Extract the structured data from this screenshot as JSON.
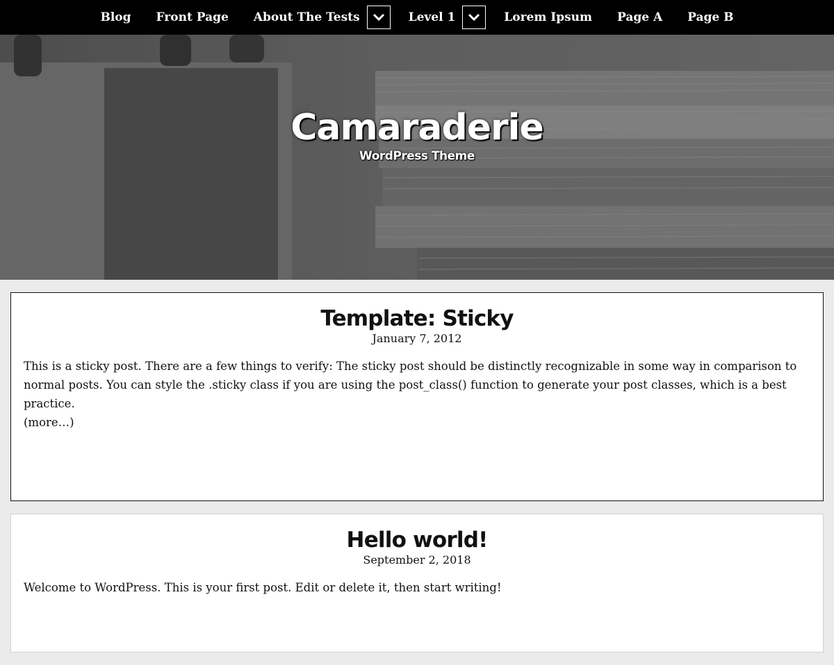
{
  "nav": {
    "items": [
      {
        "label": "Blog"
      },
      {
        "label": "Front Page"
      },
      {
        "label": "About The Tests",
        "has_submenu": true
      },
      {
        "label": "Level 1",
        "has_submenu": true
      },
      {
        "label": "Lorem Ipsum"
      },
      {
        "label": "Page A"
      },
      {
        "label": "Page B"
      }
    ],
    "submenu_icon": "chevron-down-icon"
  },
  "header": {
    "site_title": "Camaraderie",
    "site_description": "WordPress Theme"
  },
  "posts": [
    {
      "title": "Template: Sticky",
      "date": "January 7, 2012",
      "excerpt": "This is a sticky post. There are a few things to verify: The sticky post should be distinctly recognizable in some way in comparison to normal posts. You can style the .sticky class if you are using the post_class() function to generate your post classes, which is a best practice.",
      "more_label": "(more…)"
    },
    {
      "title": "Hello world!",
      "date": "September 2, 2018",
      "excerpt": "Welcome to WordPress. This is your first post. Edit or delete it, then start writing!"
    }
  ],
  "colors": {
    "nav_bg": "#000000",
    "page_bg": "#ebebeb",
    "card_bg": "#ffffff",
    "text": "#111111"
  }
}
